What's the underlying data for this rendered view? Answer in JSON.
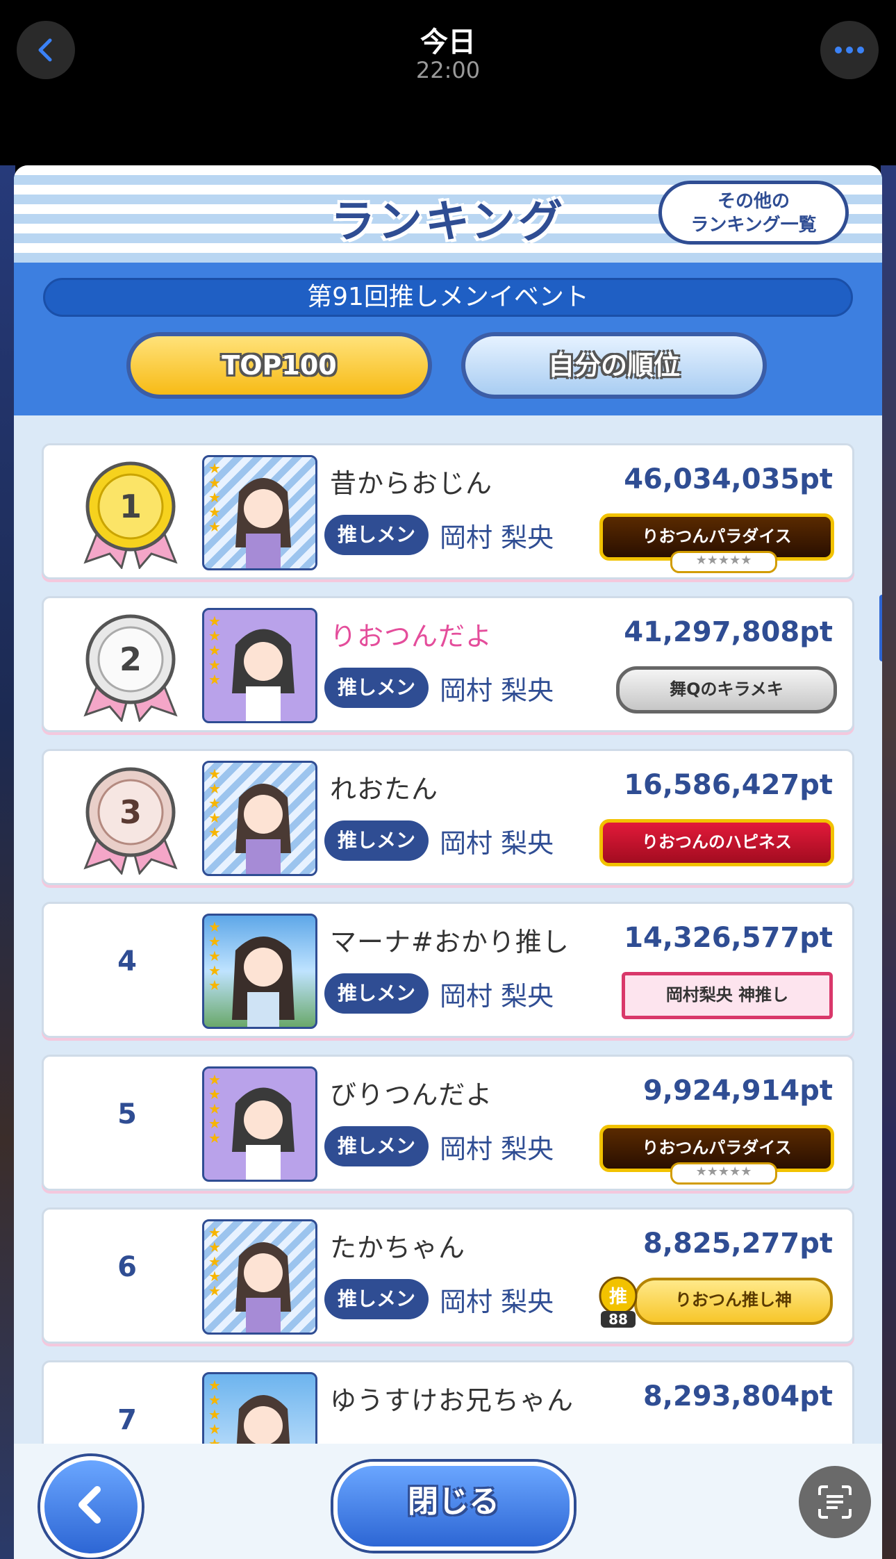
{
  "statusbar": {
    "title": "今日",
    "time": "22:00"
  },
  "header": {
    "title": "ランキング",
    "other_rankings_line1": "その他の",
    "other_rankings_line2": "ランキング一覧"
  },
  "event": {
    "name": "第91回推しメンイベント"
  },
  "tabs": [
    {
      "label": "TOP100",
      "active": true
    },
    {
      "label": "自分の順位",
      "active": false
    }
  ],
  "rows": [
    {
      "rank": "1",
      "name": "昔からおじん",
      "oshi_label": "推しメン",
      "oshi_name": "岡村 梨央",
      "points": "46,034,035pt",
      "badge": "りおつんパラダイス"
    },
    {
      "rank": "2",
      "name": "りおつんだよ",
      "oshi_label": "推しメン",
      "oshi_name": "岡村 梨央",
      "points": "41,297,808pt",
      "badge": "舞Qのキラメキ"
    },
    {
      "rank": "3",
      "name": "れおたん",
      "oshi_label": "推しメン",
      "oshi_name": "岡村 梨央",
      "points": "16,586,427pt",
      "badge": "りおつんのハピネス"
    },
    {
      "rank": "4",
      "name": "マーナ#おかり推し",
      "oshi_label": "推しメン",
      "oshi_name": "岡村 梨央",
      "points": "14,326,577pt",
      "badge": "岡村梨央 神推し"
    },
    {
      "rank": "5",
      "name": "びりつんだよ",
      "oshi_label": "推しメン",
      "oshi_name": "岡村 梨央",
      "points": "9,924,914pt",
      "badge": "りおつんパラダイス"
    },
    {
      "rank": "6",
      "name": "たかちゃん",
      "oshi_label": "推しメン",
      "oshi_name": "岡村 梨央",
      "points": "8,825,277pt",
      "badge": "りおつん推し神",
      "oshi_count_kanji": "推",
      "oshi_count": "88"
    },
    {
      "rank": "7",
      "name": "ゆうすけお兄ちゃん",
      "points": "8,293,804pt"
    }
  ],
  "footer": {
    "close_label": "閉じる"
  },
  "colors": {
    "accent": "#2f4d93",
    "tab_active": "#f7bb16",
    "name_pink": "#e44d9b"
  }
}
